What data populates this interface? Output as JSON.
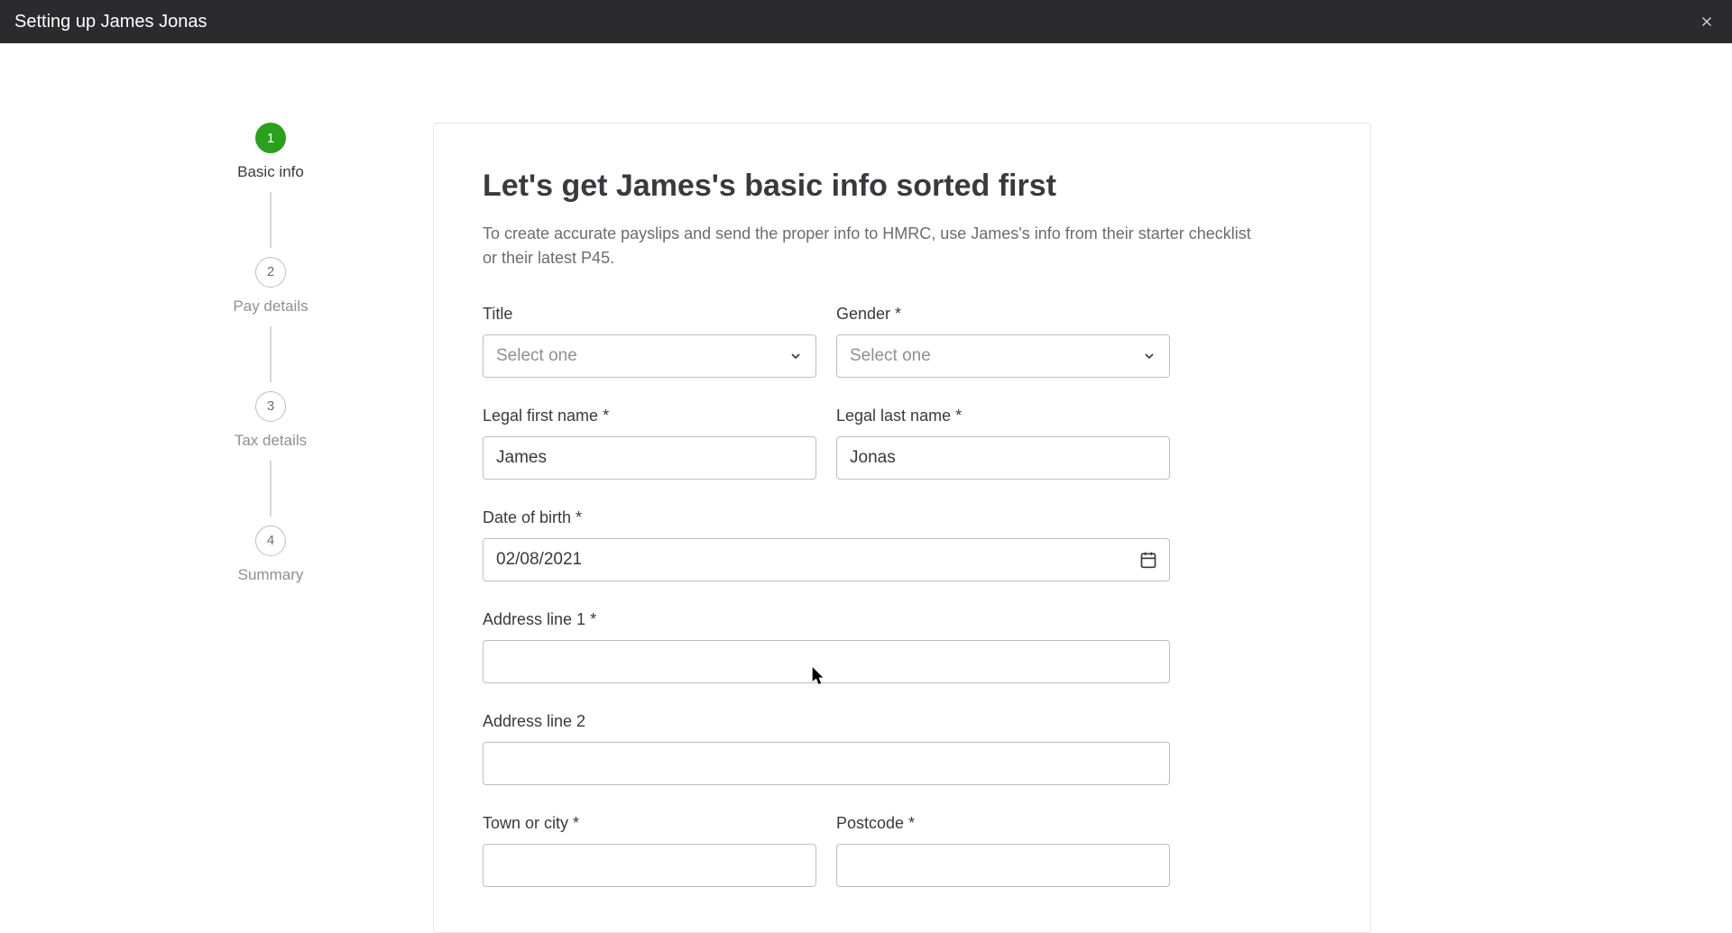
{
  "header": {
    "title": "Setting up James Jonas"
  },
  "stepper": {
    "steps": [
      {
        "num": "1",
        "label": "Basic info",
        "active": true
      },
      {
        "num": "2",
        "label": "Pay details",
        "active": false
      },
      {
        "num": "3",
        "label": "Tax details",
        "active": false
      },
      {
        "num": "4",
        "label": "Summary",
        "active": false
      }
    ]
  },
  "form": {
    "title": "Let's get James's basic info sorted first",
    "subtitle": "To create accurate payslips and send the proper info to HMRC, use James's info from their starter checklist or their latest P45.",
    "fields": {
      "title_label": "Title",
      "title_placeholder": "Select one",
      "gender_label": "Gender *",
      "gender_placeholder": "Select one",
      "first_name_label": "Legal first name *",
      "first_name_value": "James",
      "last_name_label": "Legal last name *",
      "last_name_value": "Jonas",
      "dob_label": "Date of birth *",
      "dob_value": "02/08/2021",
      "address1_label": "Address line 1 *",
      "address1_value": "",
      "address2_label": "Address line 2",
      "address2_value": "",
      "town_label": "Town or city *",
      "town_value": "",
      "postcode_label": "Postcode *",
      "postcode_value": ""
    }
  }
}
